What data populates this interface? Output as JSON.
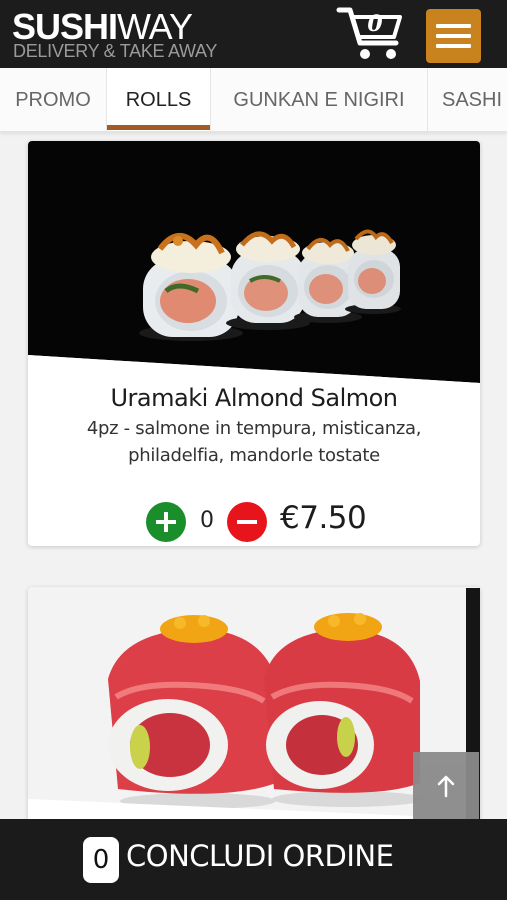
{
  "header": {
    "logo_bold": "SUSHI",
    "logo_light": "WAY",
    "logo_tagline": "DELIVERY & TAKE AWAY",
    "cart_count": "0",
    "accent_color": "#c8821e"
  },
  "tabs": [
    {
      "label": "PROMO",
      "active": false
    },
    {
      "label": "ROLLS",
      "active": true
    },
    {
      "label": "GUNKAN E NIGIRI",
      "active": false
    },
    {
      "label": "SASHI",
      "active": false
    }
  ],
  "tab_indicator_color": "#a35a24",
  "products": [
    {
      "name": "Uramaki Almond Salmon",
      "description": "4pz - salmone in tempura, misticanza, philadelfia, mandorle tostate",
      "quantity": "0",
      "price": "€7.50",
      "image": "uramaki-salmon-photo"
    },
    {
      "image": "tuna-roll-photo"
    }
  ],
  "buttons": {
    "plus_color": "#1a8e2a",
    "minus_color": "#e8141c"
  },
  "footer": {
    "order_count": "0",
    "order_label": "CONCLUDI ORDINE"
  }
}
